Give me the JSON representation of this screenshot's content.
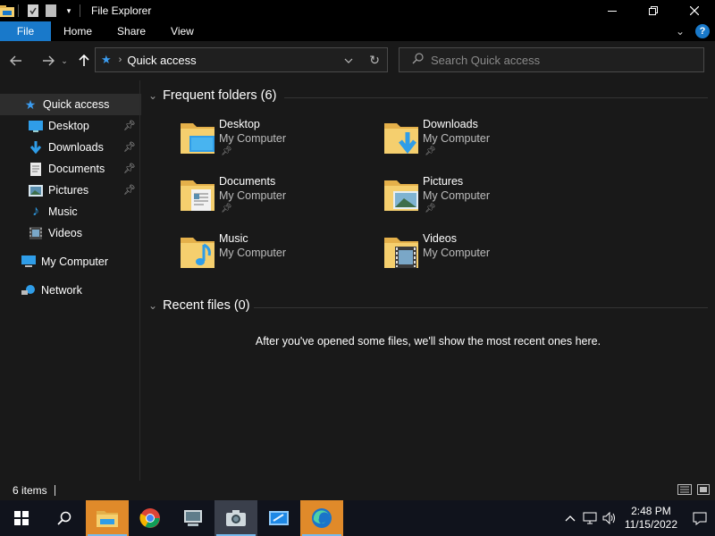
{
  "window": {
    "title": "File Explorer"
  },
  "ribbon": {
    "tabs": [
      "File",
      "Home",
      "Share",
      "View"
    ],
    "help": "?"
  },
  "address": {
    "location": "Quick access",
    "separator": "›"
  },
  "search": {
    "placeholder": "Search Quick access"
  },
  "sidebar": {
    "items": [
      {
        "label": "Quick access",
        "icon": "star-icon"
      },
      {
        "label": "Desktop",
        "icon": "desktop-icon"
      },
      {
        "label": "Downloads",
        "icon": "download-icon"
      },
      {
        "label": "Documents",
        "icon": "document-icon"
      },
      {
        "label": "Pictures",
        "icon": "picture-icon"
      },
      {
        "label": "Music",
        "icon": "music-icon"
      },
      {
        "label": "Videos",
        "icon": "video-icon"
      },
      {
        "label": "My Computer",
        "icon": "computer-icon"
      },
      {
        "label": "Network",
        "icon": "network-icon"
      }
    ]
  },
  "frequent": {
    "heading": "Frequent folders (6)",
    "folders": [
      {
        "name": "Desktop",
        "location": "My Computer",
        "pinned": true
      },
      {
        "name": "Downloads",
        "location": "My Computer",
        "pinned": true
      },
      {
        "name": "Documents",
        "location": "My Computer",
        "pinned": true
      },
      {
        "name": "Pictures",
        "location": "My Computer",
        "pinned": true
      },
      {
        "name": "Music",
        "location": "My Computer",
        "pinned": false
      },
      {
        "name": "Videos",
        "location": "My Computer",
        "pinned": false
      }
    ]
  },
  "recent": {
    "heading": "Recent files (0)",
    "empty_message": "After you've opened some files, we'll show the most recent ones here."
  },
  "status": {
    "count": "6 items"
  },
  "taskbar": {
    "time": "2:48 PM",
    "date": "11/15/2022"
  },
  "colors": {
    "accent": "#1979ca",
    "folder": "#f5cf6e",
    "taskbar_highlight": "#e08a2a"
  }
}
